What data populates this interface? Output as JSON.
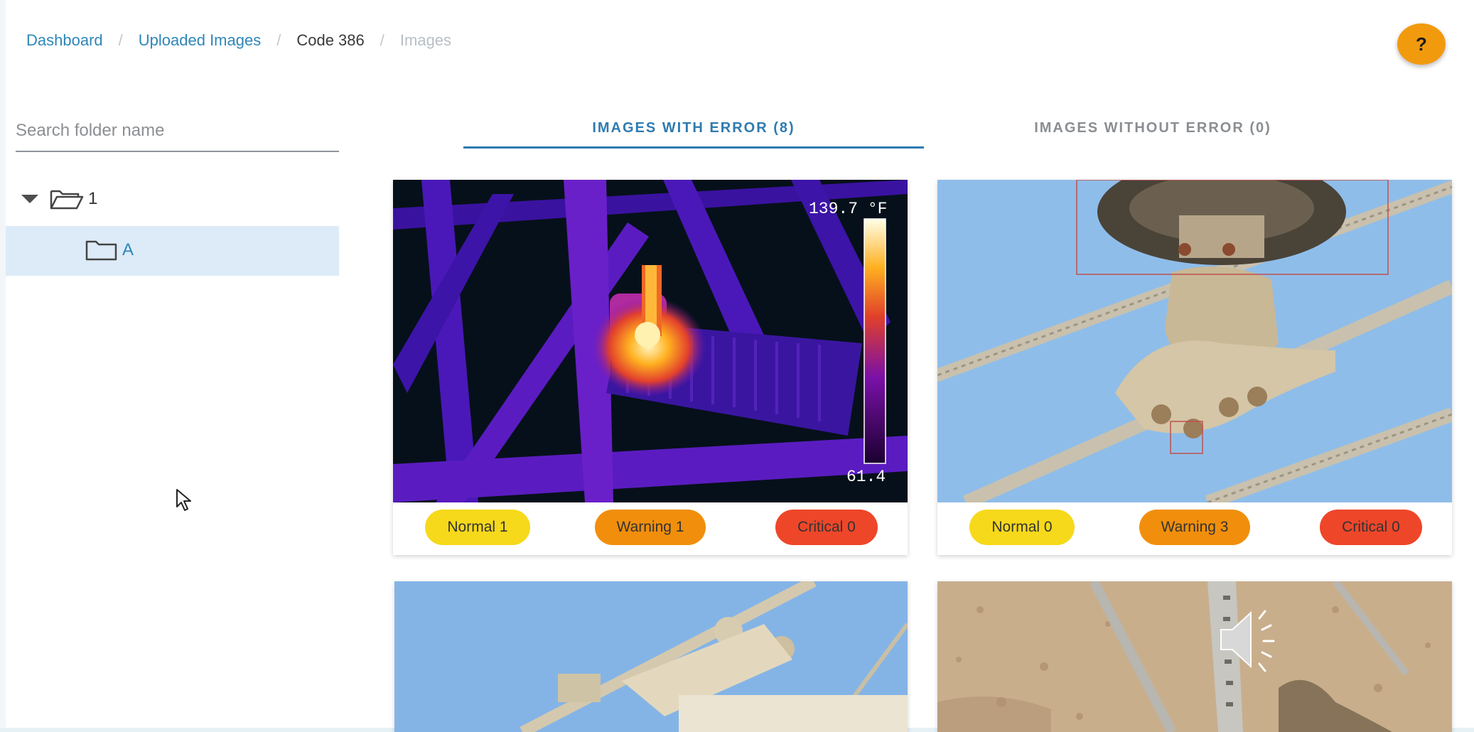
{
  "breadcrumb": {
    "dashboard": "Dashboard",
    "uploaded_images": "Uploaded Images",
    "code": "Code 386",
    "current": "Images",
    "separator": "/"
  },
  "help": {
    "label": "?"
  },
  "sidebar": {
    "search": {
      "placeholder": "Search folder name",
      "value": ""
    },
    "tree": {
      "root_label": "1",
      "child_label": "A"
    }
  },
  "tabs": {
    "with_error": "IMAGES WITH ERROR (8)",
    "without_error": "IMAGES WITHOUT ERROR (0)"
  },
  "cards": [
    {
      "badges": {
        "normal": "Normal 1",
        "warning": "Warning 1",
        "critical": "Critical 0"
      },
      "thermal": {
        "max": "139.7 °F",
        "min": "61.4"
      }
    },
    {
      "badges": {
        "normal": "Normal 0",
        "warning": "Warning 3",
        "critical": "Critical 0"
      }
    }
  ],
  "colors": {
    "accent": "#2f7bb0",
    "link": "#2f86b8",
    "normal": "#f6d91b",
    "warning": "#f18f0c",
    "critical": "#ee4629",
    "help": "#f29a0e",
    "selected_row": "#dcebf7"
  }
}
